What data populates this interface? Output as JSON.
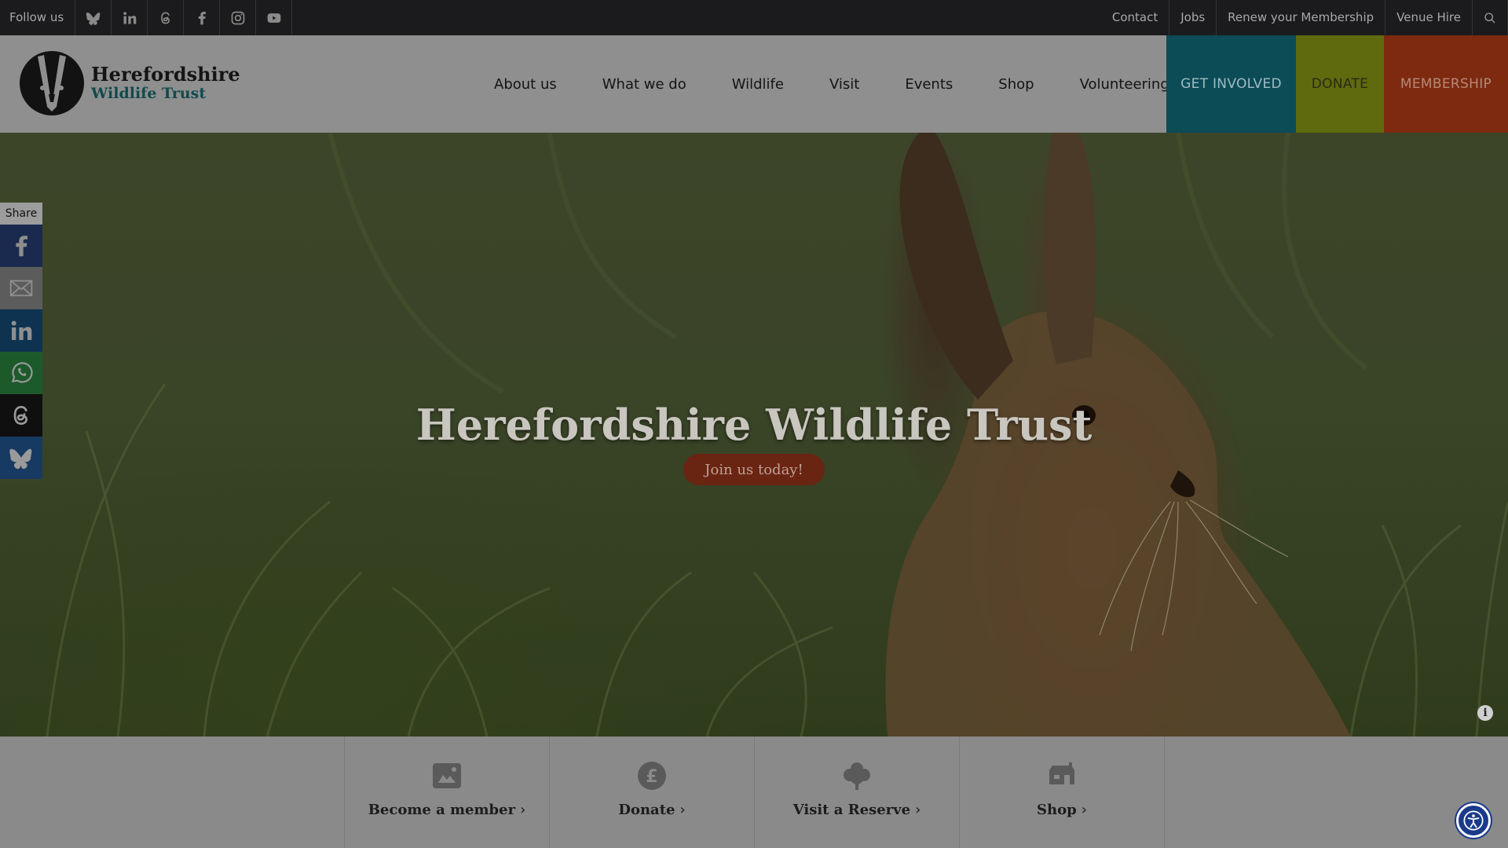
{
  "topbar": {
    "follow_label": "Follow us",
    "social": [
      "bluesky-icon",
      "linkedin-icon",
      "threads-icon",
      "facebook-icon",
      "instagram-icon",
      "youtube-icon"
    ],
    "links": [
      "Contact",
      "Jobs",
      "Renew your Membership",
      "Venue Hire"
    ]
  },
  "logo": {
    "line1": "Herefordshire",
    "line2": "Wildlife Trust"
  },
  "nav": {
    "items": [
      "About us",
      "What we do",
      "Wildlife",
      "Visit",
      "Events",
      "Shop",
      "Volunteering"
    ],
    "get_involved": "GET INVOLVED",
    "donate": "DONATE",
    "membership": "MEMBERSHIP"
  },
  "hero": {
    "title": "Herefordshire Wildlife Trust",
    "button": "Join us today!",
    "info": "i"
  },
  "share": {
    "label": "Share",
    "buttons": [
      "facebook",
      "email",
      "linkedin",
      "whatsapp",
      "threads",
      "bluesky"
    ]
  },
  "quick_links": [
    {
      "label": "Become a member",
      "icon": "membership-card-icon"
    },
    {
      "label": "Donate",
      "icon": "pound-coin-icon"
    },
    {
      "label": "Visit a Reserve",
      "icon": "tree-icon"
    },
    {
      "label": "Shop",
      "icon": "shop-icon"
    }
  ],
  "colors": {
    "get_involved": "#0b4c57",
    "donate": "#5f6a0f",
    "membership": "#7d2a10",
    "hero_button": "#6a2412"
  }
}
